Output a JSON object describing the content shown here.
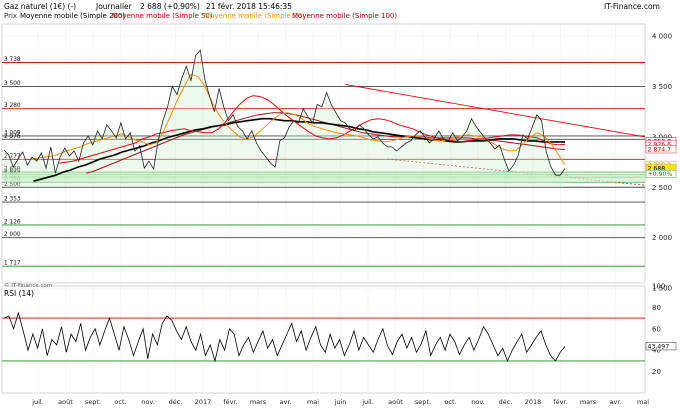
{
  "header": {
    "instrument": "Gaz naturel (1€) (-)",
    "timeframe": "Journalier",
    "last_change": "2 688 (+0,90%)",
    "datetime": "21 févr. 2018 15:46:35",
    "brand": "IT-Finance.com"
  },
  "legend": [
    {
      "label": "Prix",
      "color": "#333333"
    },
    {
      "label": "Moyenne mobile (Simple 200)",
      "color": "#000000"
    },
    {
      "label": "Moyenne mobile (Simple 50)",
      "color": "#cc0000"
    },
    {
      "label": "Moyenne mobile (Simple 20)",
      "color": "#f0901a"
    },
    {
      "label": "Moyenne mobile (Simple 100)",
      "color": "#990000"
    }
  ],
  "watermark": "© IT-Finance.com",
  "colors": {
    "price": "#222222",
    "sma200": "#000000",
    "sma50": "#d01010",
    "sma20": "#f0901a",
    "sma100": "#9a1515",
    "resistance": "#d01010",
    "support": "#1a8f1a",
    "level": "#444444",
    "rsi_line": "#000000",
    "rsi_upper": "#cc0000",
    "rsi_lower": "#1a8f1a",
    "bull_fill": "#ccf0cc",
    "bear_fill": "#f7caca"
  },
  "chart_data": [
    {
      "type": "line",
      "panel": "price",
      "ylim": [
        1550,
        4120
      ],
      "y_ticks": [
        1500,
        2000,
        2500,
        3000,
        3500,
        4000
      ],
      "x_ticks": [
        "juil.",
        "août",
        "sept.",
        "oct.",
        "nov.",
        "déc.",
        "2017",
        "févr.",
        "mars",
        "avr.",
        "mai",
        "juin",
        "juil.",
        "août",
        "sept.",
        "oct.",
        "nov.",
        "déc.",
        "2018",
        "févr.",
        "mars",
        "avr.",
        "mai"
      ],
      "horizontal_levels": [
        {
          "value": 3738,
          "label": "3 738",
          "color": "#d01010"
        },
        {
          "value": 3500,
          "label": "3 500",
          "color": "#444444"
        },
        {
          "value": 3280,
          "label": "3 280",
          "color": "#d01010"
        },
        {
          "value": 3009,
          "label": "3 009",
          "color": "#444444"
        },
        {
          "value": 2976,
          "label": "2 976",
          "color": "#444444"
        },
        {
          "value": 2777,
          "label": "2 777",
          "color": "#d01010"
        },
        {
          "value": 2650,
          "label": "2 650",
          "color": "#1a8f1a"
        },
        {
          "value": 2625,
          "label": "2 625",
          "color": "#1a8f1a"
        },
        {
          "value": 2600,
          "label": "2 600",
          "color": "#1a8f1a"
        },
        {
          "value": 2550,
          "label": "2 550",
          "color": "#1a8f1a"
        },
        {
          "value": 2500,
          "label": "2 500",
          "color": "#444444"
        },
        {
          "value": 2353,
          "label": "2 353",
          "color": "#444444"
        },
        {
          "value": 2126,
          "label": "2 126",
          "color": "#1a8f1a"
        },
        {
          "value": 2000,
          "label": "2 000",
          "color": "#444444"
        },
        {
          "value": 1717,
          "label": "1 717",
          "color": "#1a8f1a"
        }
      ],
      "right_labels": [
        {
          "value": 2953.7,
          "label": "2 953,7",
          "style": "black"
        },
        {
          "value": 2926.6,
          "label": "2 926,6",
          "style": "red"
        },
        {
          "value": 2874.7,
          "label": "2 874,7",
          "style": "red"
        },
        {
          "value": 2719.8,
          "label": "2 719,8",
          "style": "orange"
        },
        {
          "value": 2688,
          "label": "2 688",
          "style": "last"
        },
        {
          "value": 2630,
          "label": "+0,90%",
          "style": "change"
        }
      ],
      "series": [
        {
          "name": "Prix",
          "values": [
            2870,
            2820,
            2700,
            2780,
            2850,
            2720,
            2800,
            2760,
            2840,
            2690,
            2900,
            2640,
            2800,
            2890,
            2810,
            2860,
            2760,
            2940,
            3010,
            2920,
            3060,
            2980,
            3120,
            3060,
            2990,
            3140,
            2980,
            3040,
            2860,
            2910,
            2690,
            2760,
            2680,
            2970,
            3160,
            3300,
            3500,
            3420,
            3580,
            3700,
            3560,
            3810,
            3860,
            3560,
            3400,
            3250,
            3480,
            3300,
            3160,
            3220,
            3100,
            3060,
            2980,
            3060,
            2940,
            2860,
            2800,
            2740,
            2700,
            2960,
            2990,
            3100,
            3160,
            3140,
            3280,
            3200,
            3140,
            3320,
            3300,
            3440,
            3320,
            3240,
            3160,
            3140,
            3080,
            3060,
            3120,
            3080,
            3020,
            2980,
            3000,
            2940,
            2900,
            2900,
            2860,
            2900,
            2940,
            2960,
            3020,
            3060,
            3000,
            2940,
            2980,
            3060,
            2980,
            2960,
            3040,
            2960,
            3000,
            3060,
            3180,
            3100,
            3040,
            2980,
            2940,
            2880,
            2920,
            2780,
            2660,
            2720,
            2820,
            3020,
            2980,
            3100,
            3220,
            3160,
            2850,
            2700,
            2620,
            2620,
            2688
          ]
        },
        {
          "name": "Moyenne mobile (Simple 200)",
          "values": [
            null,
            null,
            null,
            null,
            2560,
            2580,
            2600,
            2620,
            2650,
            2670,
            2700,
            2720,
            2750,
            2780,
            2800,
            2820,
            2850,
            2870,
            2890,
            2910,
            2940,
            2960,
            2990,
            3010,
            3030,
            3050,
            3070,
            3080,
            3100,
            3110,
            3120,
            3140,
            3150,
            3160,
            3170,
            3180,
            3180,
            3170,
            3160,
            3160,
            3150,
            3150,
            3140,
            3140,
            3130,
            3120,
            3110,
            3100,
            3080,
            3070,
            3050,
            3040,
            3030,
            3020,
            3010,
            3000,
            2990,
            2980,
            2970,
            2970,
            2960,
            2950,
            2950,
            2960,
            2960,
            2960,
            2970,
            2980,
            2980,
            2980,
            2970,
            2960,
            2960,
            2950,
            2950,
            2950,
            2950
          ]
        },
        {
          "name": "Moyenne mobile (Simple 50)",
          "values": [
            null,
            null,
            null,
            null,
            null,
            null,
            null,
            null,
            2740,
            2750,
            2760,
            2780,
            2800,
            2820,
            2840,
            2860,
            2880,
            2900,
            2920,
            2940,
            2980,
            3000,
            3030,
            3040,
            3060,
            3070,
            3080,
            3060,
            3050,
            3040,
            3040,
            3080,
            3150,
            3240,
            3320,
            3380,
            3410,
            3400,
            3370,
            3320,
            3260,
            3200,
            3150,
            3100,
            3050,
            3010,
            2990,
            2980,
            2990,
            3020,
            3060,
            3100,
            3140,
            3170,
            3180,
            3170,
            3150,
            3120,
            3100,
            3080,
            3050,
            3020,
            3000,
            2980,
            2970,
            2960,
            2950,
            2960,
            2970,
            2980,
            2990,
            3000,
            3010,
            3020,
            3020,
            3010,
            3000,
            2990,
            2960,
            2930,
            2920,
            2926.6
          ]
        },
        {
          "name": "Moyenne mobile (Simple 20)",
          "values": [
            null,
            null,
            null,
            null,
            2780,
            2790,
            2800,
            2810,
            2830,
            2860,
            2880,
            2900,
            2930,
            2950,
            2970,
            2990,
            3010,
            3030,
            3000,
            2970,
            2950,
            2920,
            2940,
            3050,
            3200,
            3360,
            3500,
            3620,
            3600,
            3500,
            3350,
            3220,
            3130,
            3060,
            3000,
            2980,
            3000,
            3060,
            3120,
            3180,
            3230,
            3240,
            3220,
            3180,
            3130,
            3100,
            3080,
            3060,
            3040,
            3030,
            3020,
            3010,
            2990,
            2970,
            2960,
            2950,
            2960,
            2980,
            3000,
            3010,
            3000,
            2990,
            2970,
            2960,
            2970,
            2990,
            3010,
            3020,
            3010,
            3000,
            2960,
            2920,
            2880,
            2860,
            2870,
            2930,
            3000,
            3040,
            3010,
            2930,
            2830,
            2719.8
          ]
        },
        {
          "name": "Moyenne mobile (Simple 100)",
          "values": [
            null,
            null,
            null,
            null,
            null,
            null,
            null,
            null,
            null,
            null,
            null,
            2640,
            2660,
            2690,
            2720,
            2750,
            2780,
            2810,
            2840,
            2870,
            2900,
            2930,
            2960,
            2990,
            3020,
            3040,
            3060,
            3080,
            3100,
            3120,
            3140,
            3160,
            3180,
            3200,
            3220,
            3230,
            3240,
            3240,
            3230,
            3220,
            3200,
            3180,
            3160,
            3140,
            3120,
            3100,
            3080,
            3060,
            3040,
            3030,
            3020,
            3010,
            3000,
            3000,
            3000,
            3000,
            3000,
            2990,
            2990,
            2990,
            2990,
            2990,
            2990,
            2980,
            2980,
            2970,
            2960,
            2950,
            2940,
            2930,
            2920,
            2910,
            2900,
            2890,
            2880,
            2874.7
          ]
        }
      ]
    },
    {
      "type": "line",
      "panel": "rsi",
      "title": "RSI (14)",
      "ylim": [
        0,
        100
      ],
      "y_ticks": [
        20,
        40,
        60,
        80,
        100
      ],
      "levels": [
        70,
        30
      ],
      "last_value_label": "43,497",
      "series": [
        {
          "name": "RSI (14)",
          "values": [
            70,
            72,
            60,
            75,
            58,
            40,
            55,
            42,
            60,
            35,
            50,
            45,
            62,
            38,
            55,
            48,
            65,
            40,
            52,
            60,
            45,
            58,
            70,
            55,
            40,
            62,
            50,
            35,
            48,
            60,
            32,
            55,
            45,
            65,
            72,
            68,
            58,
            50,
            62,
            48,
            40,
            55,
            35,
            45,
            30,
            50,
            40,
            60,
            55,
            35,
            45,
            52,
            38,
            48,
            58,
            42,
            50,
            35,
            45,
            55,
            65,
            48,
            58,
            40,
            52,
            62,
            45,
            38,
            55,
            42,
            50,
            35,
            45,
            58,
            40,
            52,
            45,
            38,
            50,
            60,
            44,
            36,
            48,
            55,
            42,
            52,
            38,
            46,
            58,
            35,
            45,
            52,
            40,
            55,
            48,
            36,
            45,
            52,
            40,
            50,
            62,
            55,
            45,
            35,
            42,
            30,
            40,
            48,
            55,
            38,
            45,
            52,
            58,
            45,
            35,
            30,
            38,
            43.497
          ]
        }
      ]
    }
  ]
}
